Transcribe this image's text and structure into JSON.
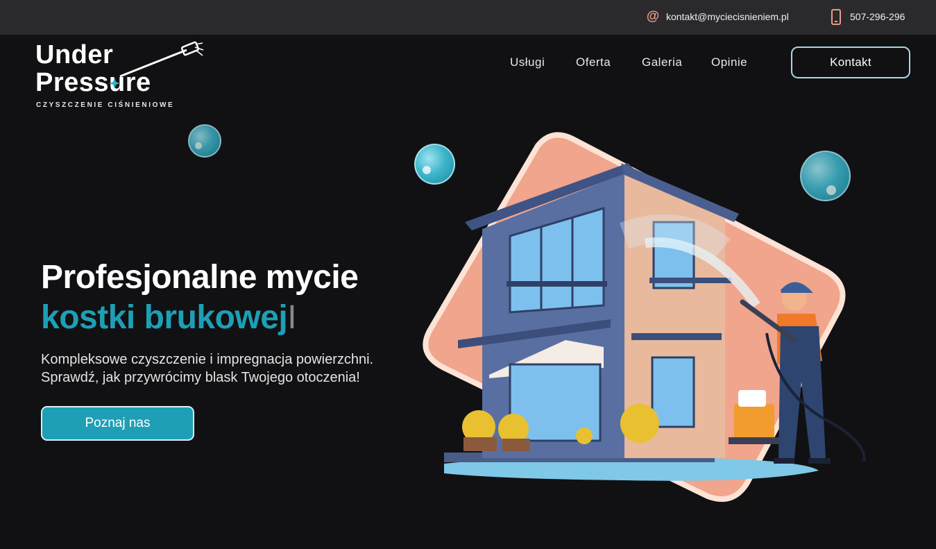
{
  "topbar": {
    "email": "kontakt@myciecisnieniem.pl",
    "phone": "507-296-296",
    "email_icon": "at-icon",
    "phone_icon": "phone-icon"
  },
  "logo": {
    "line1": "Under",
    "line2": "Pressure",
    "subtitle": "CZYSZCZENIE CIŚNIENIOWE"
  },
  "nav": {
    "items": [
      "Usługi",
      "Oferta",
      "Galeria",
      "Opinie"
    ],
    "contact_button": "Kontakt"
  },
  "hero": {
    "title_line1": "Profesjonalne mycie",
    "title_line2": "kostki brukowej",
    "cursor": "I",
    "subtitle_line1": "Kompleksowe czyszczenie i impregnacja powierzchni.",
    "subtitle_line2": "Sprawdź, jak przywrócimy blask Twojego otoczenia!",
    "cta": "Poznaj nas"
  },
  "colors": {
    "accent": "#1e9fb5",
    "icon": "#e79c82",
    "background": "#111113",
    "topbar": "#2a2a2d",
    "shape": "#f0a58c"
  }
}
